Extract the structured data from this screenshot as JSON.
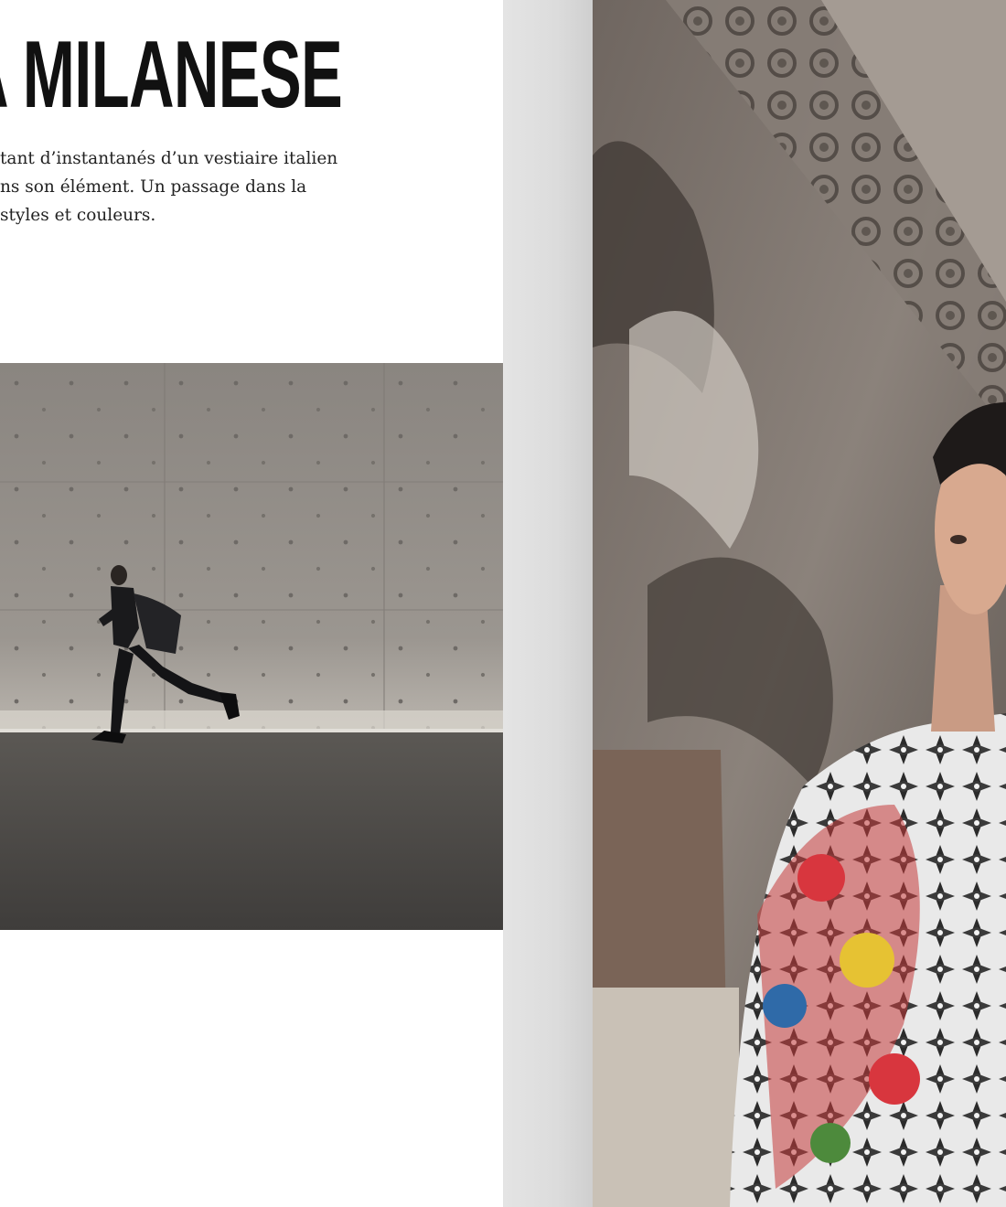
{
  "article": {
    "title": "A MILANESE",
    "intro_lines": [
      "tant d’instantanés d’un vestiaire italien",
      "ns son élément. Un passage dans la",
      "styles et couleurs."
    ]
  },
  "photos": {
    "left": {
      "subject": "man running past concrete wall"
    },
    "right": {
      "subject": "man in patterned shirt before gothic cathedral"
    }
  },
  "colors": {
    "page": "#ffffff",
    "gutter": "#dcdcdc",
    "headline": "#111111",
    "concrete": "#8d8883"
  }
}
